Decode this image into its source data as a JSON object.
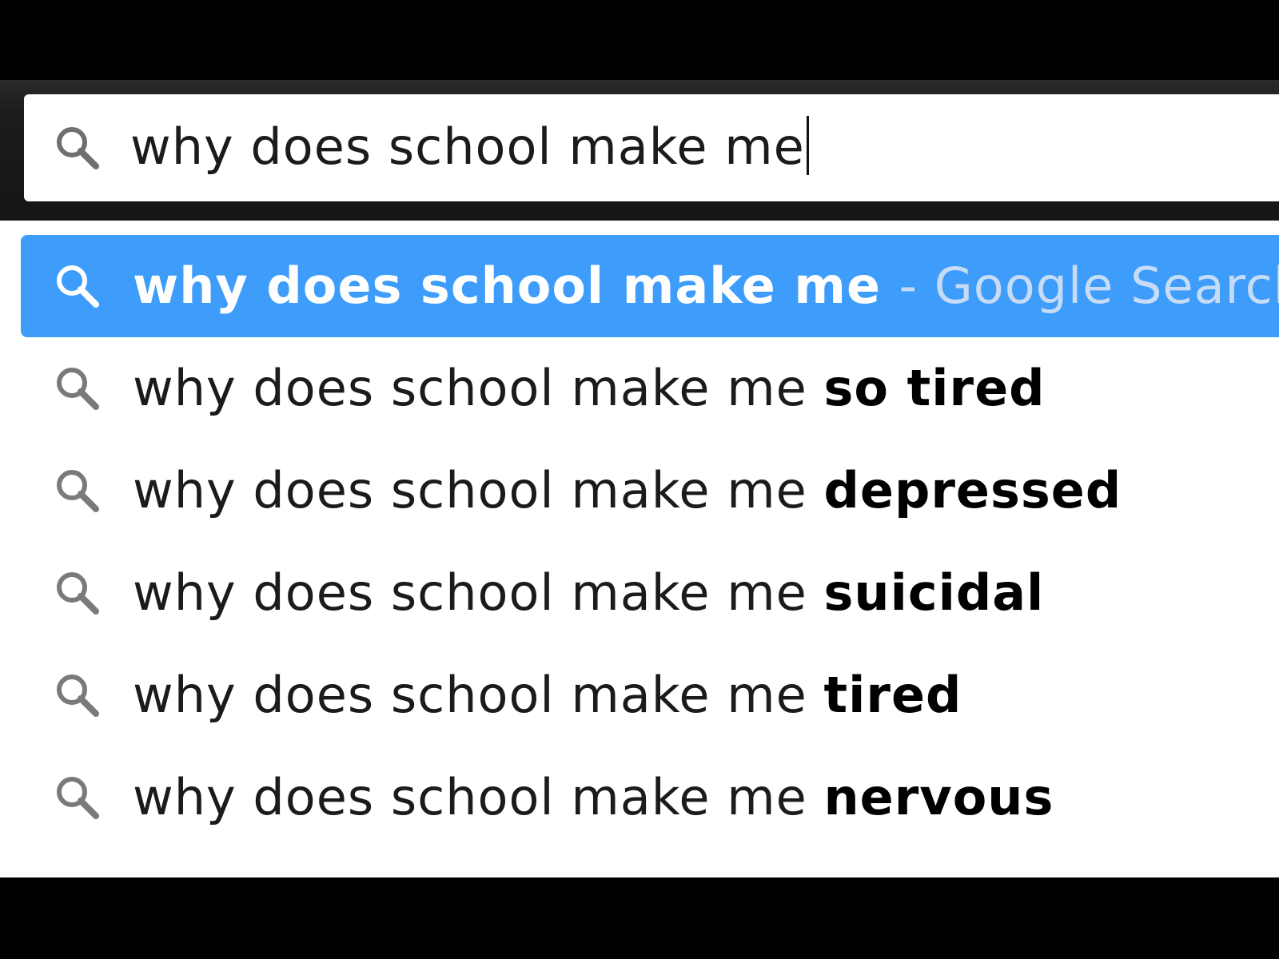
{
  "omnibox": {
    "query": "why does school make me",
    "icon": "search-icon"
  },
  "suggestions": [
    {
      "prefix": "why does school make me",
      "completion": "",
      "suffix": "- Google Search",
      "selected": true,
      "icon": "search-icon"
    },
    {
      "prefix": "why does school make me",
      "completion": "so tired",
      "suffix": "",
      "selected": false,
      "icon": "search-icon"
    },
    {
      "prefix": "why does school make me",
      "completion": "depressed",
      "suffix": "",
      "selected": false,
      "icon": "search-icon"
    },
    {
      "prefix": "why does school make me",
      "completion": "suicidal",
      "suffix": "",
      "selected": false,
      "icon": "search-icon"
    },
    {
      "prefix": "why does school make me",
      "completion": "tired",
      "suffix": "",
      "selected": false,
      "icon": "search-icon"
    },
    {
      "prefix": "why does school make me",
      "completion": "nervous",
      "suffix": "",
      "selected": false,
      "icon": "search-icon"
    }
  ],
  "colors": {
    "selected_row": "#3e9cfb",
    "selected_suffix": "#c6dcf6",
    "icon_gray": "#7a7a7a"
  }
}
